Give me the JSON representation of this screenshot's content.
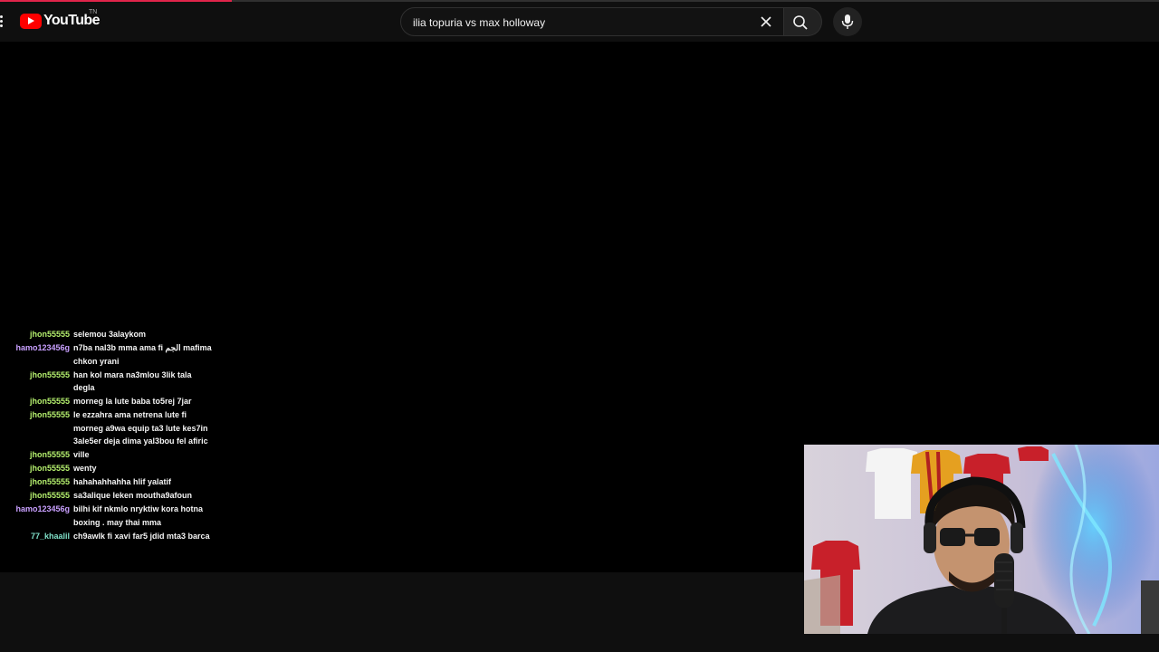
{
  "load_bar": {
    "progress": 0.2,
    "color": "#e0244a"
  },
  "masthead": {
    "logo_text": "YouTube",
    "logo_tm": "TN",
    "search": {
      "value": "ilia topuria vs max holloway",
      "placeholder": "Search"
    }
  },
  "icons": {
    "menu": "menu-icon",
    "clear": "close-icon",
    "search": "search-icon",
    "mic": "microphone-icon"
  },
  "chat": {
    "messages": [
      {
        "user": "jhon55555",
        "user_color": "#b5f06e",
        "text": "selemou 3alaykom"
      },
      {
        "user": "hamo123456g",
        "user_color": "#c9a0ff",
        "text": "n7ba nal3b mma ama fi الجم mafima chkon yrani"
      },
      {
        "user": "jhon55555",
        "user_color": "#b5f06e",
        "text": "han kol mara na3mlou 3lik tala degla"
      },
      {
        "user": "jhon55555",
        "user_color": "#b5f06e",
        "text": "morneg la lute baba to5rej 7jar"
      },
      {
        "user": "jhon55555",
        "user_color": "#b5f06e",
        "text": "le ezzahra ama netrena lute fi morneg a9wa equip ta3 lute kes7in 3ale5er deja dima yal3bou fel afiric"
      },
      {
        "user": "jhon55555",
        "user_color": "#b5f06e",
        "text": "ville"
      },
      {
        "user": "jhon55555",
        "user_color": "#b5f06e",
        "text": "wenty"
      },
      {
        "user": "jhon55555",
        "user_color": "#b5f06e",
        "text": "hahahahhahha hlif yalatif"
      },
      {
        "user": "jhon55555",
        "user_color": "#b5f06e",
        "text": "sa3alique leken moutha9afoun"
      },
      {
        "user": "hamo123456g",
        "user_color": "#c9a0ff",
        "text": "bilhi kif nkmlo nryktiw kora hotna boxing . may thai mma"
      },
      {
        "user": "77_khaalil",
        "user_color": "#7fe0c8",
        "text": "ch9awlk fi xavi far5 jdid mta3 barca"
      }
    ]
  }
}
